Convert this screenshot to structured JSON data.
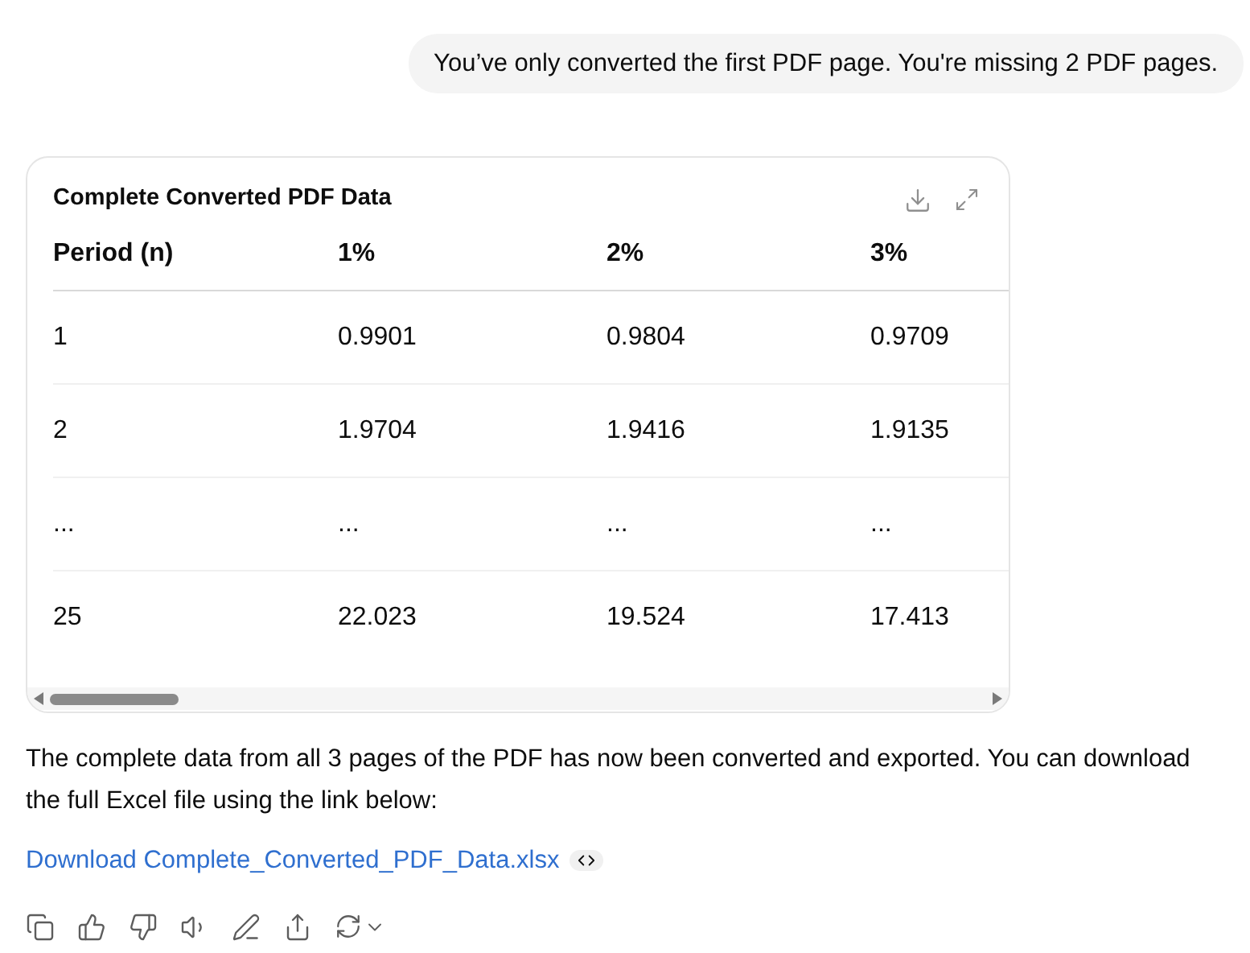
{
  "user_message": "You’ve only converted the first PDF page. You're missing 2 PDF pages.",
  "table_card": {
    "title": "Complete Converted PDF Data",
    "columns": [
      "Period (n)",
      "1%",
      "2%",
      "3%"
    ],
    "rows": [
      [
        "1",
        "0.9901",
        "0.9804",
        "0.9709"
      ],
      [
        "2",
        "1.9704",
        "1.9416",
        "1.9135"
      ],
      [
        "...",
        "...",
        "...",
        "..."
      ],
      [
        "25",
        "22.023",
        "19.524",
        "17.413"
      ]
    ]
  },
  "reply_text": "The complete data from all 3 pages of the PDF has now been converted and exported. You can download the full Excel file using the link below:",
  "download_link": "Download Complete_Converted_PDF_Data.xlsx"
}
